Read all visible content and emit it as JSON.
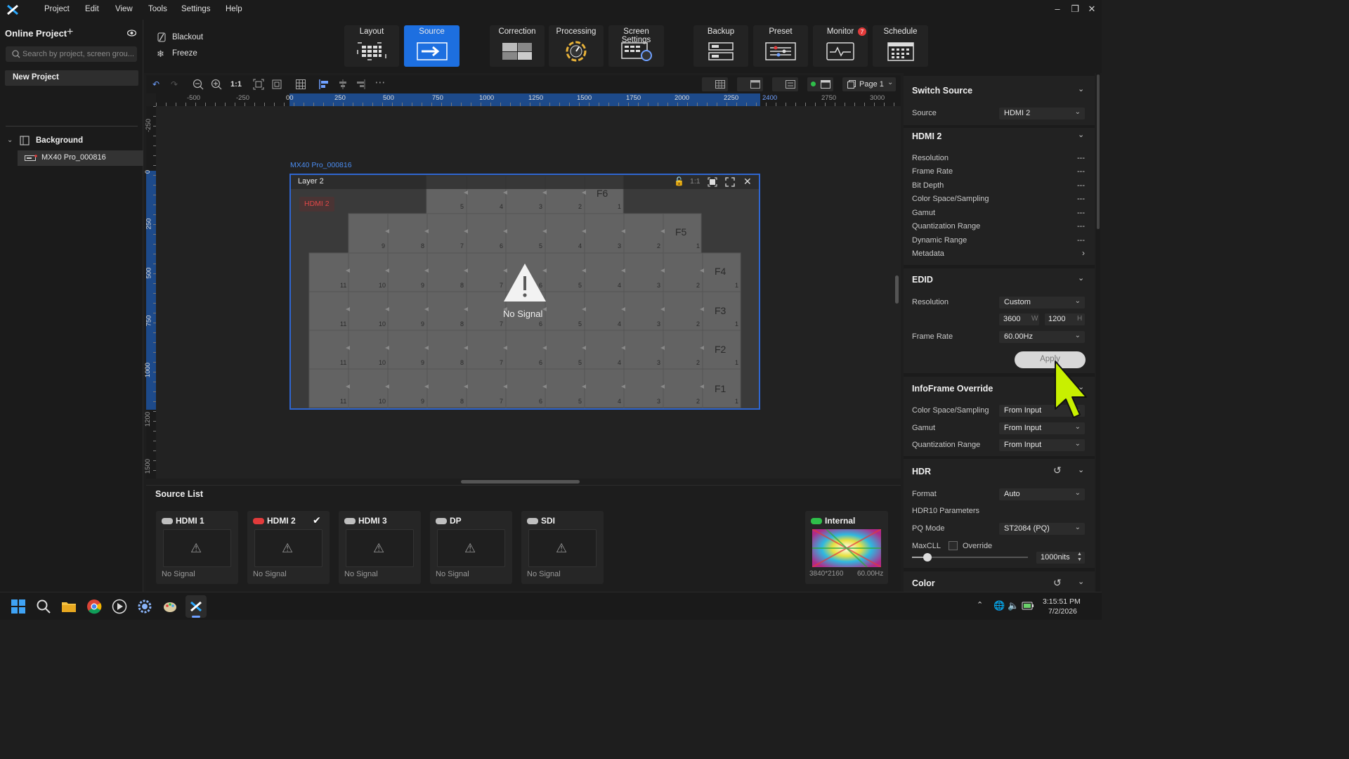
{
  "menu": {
    "items": [
      "Project",
      "Edit",
      "View",
      "Tools",
      "Settings",
      "Help"
    ]
  },
  "project": {
    "title": "Online Project",
    "search_placeholder": "Search by project, screen grou...",
    "new_project": "New Project",
    "tree": {
      "group": "Background",
      "device": "MX40 Pro_000816"
    }
  },
  "quick": {
    "blackout": "Blackout",
    "freeze": "Freeze"
  },
  "tabs": {
    "layout": "Layout",
    "source": "Source",
    "correction": "Correction",
    "processing": "Processing",
    "screen_settings": "Screen Settings",
    "backup": "Backup",
    "preset": "Preset",
    "monitor": "Monitor",
    "monitor_badge": "7",
    "schedule": "Schedule"
  },
  "canvas_tools": {
    "ratio": "1:1",
    "page": "Page 1"
  },
  "ruler": {
    "h": [
      "-500",
      "-250",
      "00",
      "250",
      "500",
      "750",
      "1000",
      "1250",
      "1500",
      "1750",
      "2000",
      "2250",
      "2400",
      "2750",
      "3000"
    ],
    "v": [
      "-250",
      "0",
      "250",
      "500",
      "750",
      "1000",
      "1200",
      "1500"
    ]
  },
  "canvas": {
    "device_label": "MX40 Pro_000816",
    "layer_name": "Layer 2",
    "layer_ratio": "1:1",
    "source_tag": "HDMI 2",
    "no_signal": "No Signal",
    "panels": [
      "F6",
      "F5",
      "F4",
      "F3",
      "F2",
      "F1"
    ]
  },
  "source_list": {
    "title": "Source List",
    "sources": [
      {
        "name": "HDMI 1",
        "status": "No Signal"
      },
      {
        "name": "HDMI 2",
        "status": "No Signal"
      },
      {
        "name": "HDMI 3",
        "status": "No Signal"
      },
      {
        "name": "DP",
        "status": "No Signal"
      },
      {
        "name": "SDI",
        "status": "No Signal"
      }
    ],
    "internal": {
      "name": "Internal",
      "resolution": "3840*2160",
      "rate": "60.00Hz"
    }
  },
  "panel": {
    "switch": {
      "title": "Switch Source",
      "source_label": "Source",
      "source_value": "HDMI 2"
    },
    "hdmi": {
      "title": "HDMI 2",
      "rows": [
        {
          "label": "Resolution",
          "value": "---"
        },
        {
          "label": "Frame Rate",
          "value": "---"
        },
        {
          "label": "Bit Depth",
          "value": "---"
        },
        {
          "label": "Color Space/Sampling",
          "value": "---"
        },
        {
          "label": "Gamut",
          "value": "---"
        },
        {
          "label": "Quantization Range",
          "value": "---"
        },
        {
          "label": "Dynamic Range",
          "value": "---"
        }
      ],
      "metadata": "Metadata"
    },
    "edid": {
      "title": "EDID",
      "resolution_label": "Resolution",
      "resolution_value": "Custom",
      "w": "3600",
      "w_unit": "W",
      "h": "1200",
      "h_unit": "H",
      "frame_rate_label": "Frame Rate",
      "frame_rate_value": "60.00Hz",
      "apply": "Apply"
    },
    "infoframe": {
      "title": "InfoFrame Override",
      "color_label": "Color Space/Sampling",
      "color_value": "From Input",
      "gamut_label": "Gamut",
      "gamut_value": "From Input",
      "quant_label": "Quantization Range",
      "quant_value": "From Input"
    },
    "hdr": {
      "title": "HDR",
      "format_label": "Format",
      "format_value": "Auto",
      "params": "HDR10 Parameters",
      "pq_label": "PQ Mode",
      "pq_value": "ST2084 (PQ)",
      "maxcll_label": "MaxCLL",
      "override_label": "Override",
      "nits": "1000nits"
    },
    "color": {
      "title": "Color"
    }
  },
  "taskbar": {
    "time": "3:15:51 PM",
    "date": "7/2/2026"
  },
  "colors": {
    "accent": "#1d6fe0",
    "danger": "#e23b3b",
    "signal_ok": "#2fbf4a",
    "cursor": "#c8f000"
  }
}
